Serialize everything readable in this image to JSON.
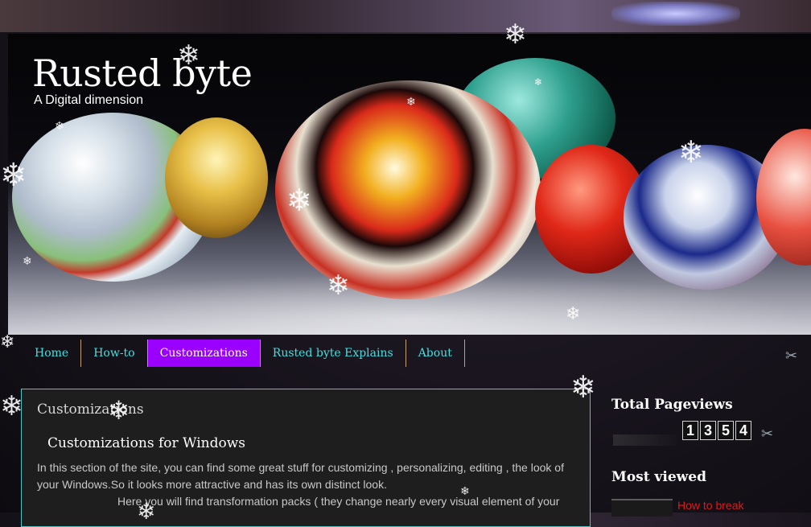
{
  "blog": {
    "title": "Rusted byte",
    "description": "A Digital dimension"
  },
  "nav": {
    "items": [
      {
        "label": "Home",
        "active": false
      },
      {
        "label": "How-to",
        "active": false
      },
      {
        "label": "Customizations",
        "active": true
      },
      {
        "label": "Rusted byte Explains",
        "active": false
      },
      {
        "label": "About",
        "active": false
      }
    ]
  },
  "main": {
    "category_title": "Customizations",
    "post_title": "Customizations for Windows",
    "post_paragraph_1": "In this section of the site, you can find some great stuff for customizing , personalizing, editing , the look of your Windows.So it looks more attractive and has its own distinct look.",
    "post_paragraph_2": "Here you will find transformation packs ( they change nearly every visual element of your"
  },
  "sidebar": {
    "pageviews_title": "Total Pageviews",
    "pageviews_digits": [
      "1",
      "3",
      "5",
      "4"
    ],
    "most_viewed_title": "Most viewed",
    "most_viewed_first": "How to break"
  },
  "colors": {
    "nav_text": "#40e0e0",
    "nav_active_bg": "#9900ff",
    "card_border": "#4cc3c8",
    "link_red": "#e01818"
  },
  "icons": [
    "snowflake-icon",
    "wrench-icon"
  ]
}
